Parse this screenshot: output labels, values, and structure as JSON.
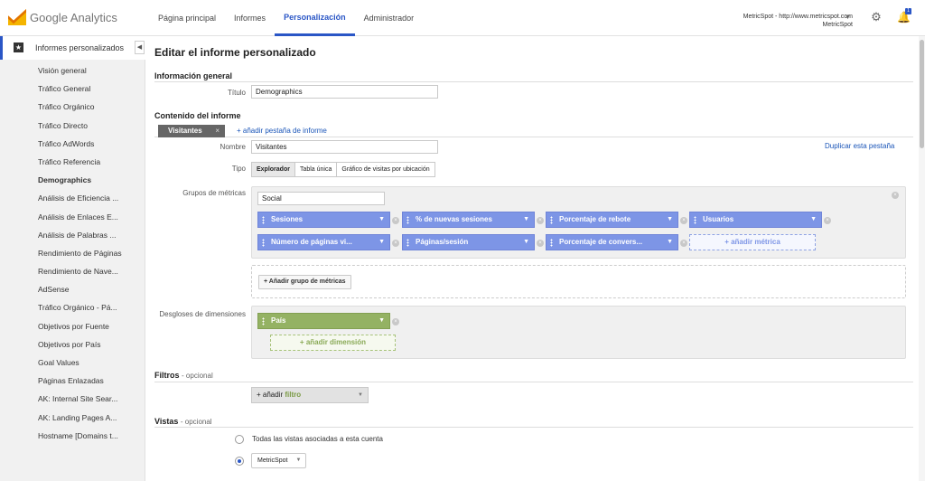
{
  "app": {
    "logo": "Google Analytics"
  },
  "nav": [
    "Página principal",
    "Informes",
    "Personalización",
    "Administrador"
  ],
  "account": {
    "line1": "MetricSpot - http://www.metricspot.com",
    "line2": "MetricSpot"
  },
  "notifications": {
    "count": "1"
  },
  "sidebar": {
    "header": "Informes personalizados",
    "items": [
      "Visión general",
      "Tráfico General",
      "Tráfico Orgánico",
      "Tráfico Directo",
      "Tráfico AdWords",
      "Tráfico Referencia",
      "Demographics",
      "Análisis de Eficiencia ...",
      "Análisis de Enlaces E...",
      "Análisis de Palabras ...",
      "Rendimiento de Páginas",
      "Rendimiento de Nave...",
      "AdSense",
      "Tráfico Orgánico - Pá...",
      "Objetivos por Fuente",
      "Objetivos por País",
      "Goal Values",
      "Páginas Enlazadas",
      "AK: Internal Site Sear...",
      "AK: Landing Pages A...",
      "Hostname [Domains t..."
    ],
    "active": "Demographics"
  },
  "page": {
    "title": "Editar el informe personalizado"
  },
  "general": {
    "section": "Información general",
    "title_label": "Título",
    "title_value": "Demographics"
  },
  "content": {
    "section": "Contenido del informe",
    "tab_name": "Visitantes",
    "tab_close": "×",
    "add_tab": "+ añadir pestaña de informe",
    "duplicate": "Duplicar esta pestaña",
    "name_label": "Nombre",
    "name_value": "Visitantes",
    "type_label": "Tipo",
    "types": [
      "Explorador",
      "Tabla única",
      "Gráfico de visitas por ubicación"
    ],
    "metric_groups_label": "Grupos de métricas",
    "metric_group_name": "Social",
    "metrics": [
      "Sesiones",
      "% de nuevas sesiones",
      "Porcentaje de rebote",
      "Usuarios",
      "Número de páginas vi...",
      "Páginas/sesión",
      "Porcentaje de convers..."
    ],
    "add_metric": "+ añadir métrica",
    "add_metric_group": "+ Añadir grupo de métricas",
    "dimensions_label": "Desgloses de dimensiones",
    "dimension": "País",
    "add_dimension": "+ añadir dimensión"
  },
  "filters": {
    "section": "Filtros",
    "optional": "- opcional",
    "add": "+ añadir",
    "add_hl": "filtro"
  },
  "views": {
    "section": "Vistas",
    "optional": "- opcional",
    "all": "Todas las vistas asociadas a esta cuenta",
    "selected": "MetricSpot"
  }
}
